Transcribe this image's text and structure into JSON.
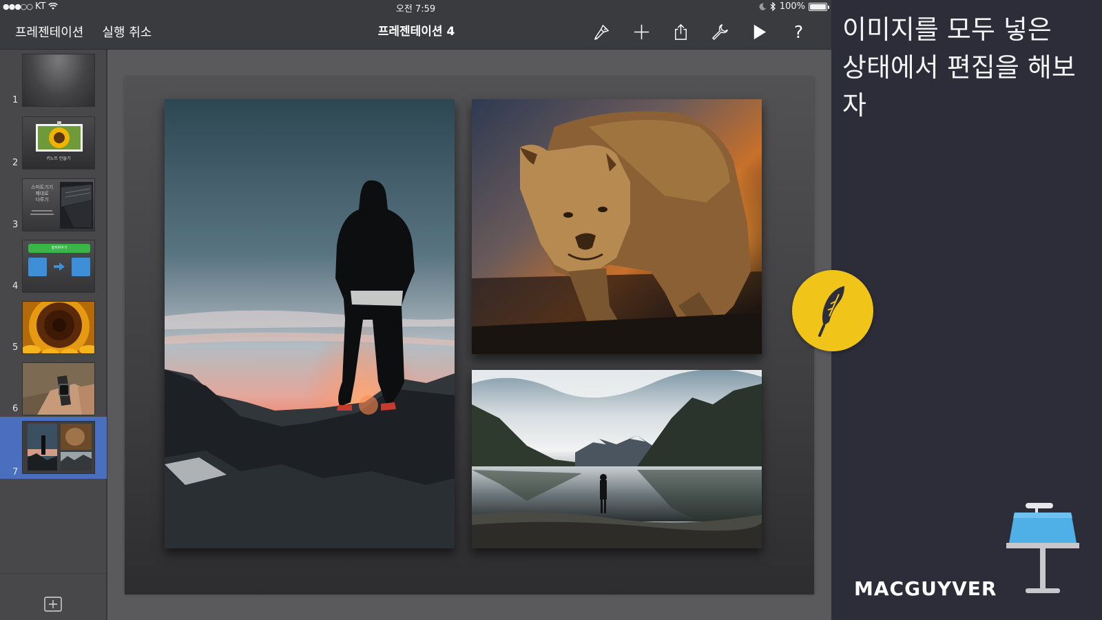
{
  "status_bar": {
    "carrier": "KT",
    "signal_dots": "●●●○○",
    "time": "오전 7:59",
    "battery": "100%",
    "battery_level": 1.0
  },
  "toolbar": {
    "presentations_label": "프레젠테이션",
    "undo_label": "실행 취소",
    "title": "프레젠테이션 4",
    "icons": [
      "format-brush-icon",
      "add-icon",
      "share-icon",
      "wrench-icon",
      "play-icon",
      "help-icon"
    ],
    "help_label": "?"
  },
  "sidebar": {
    "slides": [
      {
        "number": "1",
        "selected": false
      },
      {
        "number": "2",
        "caption": "키노트 만들기",
        "selected": false
      },
      {
        "number": "3",
        "text_lines": [
          "스마트기기",
          "제대로",
          "다루기"
        ],
        "selected": false
      },
      {
        "number": "4",
        "banner": "앞뒤바꾸기",
        "selected": false
      },
      {
        "number": "5",
        "selected": false
      },
      {
        "number": "6",
        "selected": false
      },
      {
        "number": "7",
        "selected": true
      }
    ],
    "add_slide_icon": "plus-square-icon",
    "selected_color": "#4a6fbf"
  },
  "right_panel": {
    "caption": "이미지를 모두 넣은\n상태에서 편집을 해보\n자",
    "brand": "MACGUYVER",
    "badge_icon": "feather-icon",
    "badge_color": "#f0c419",
    "logo_icon": "keynote-podium-icon"
  },
  "colors": {
    "toolbar_bg": "#3a3b3e",
    "panel_bg": "#2d2d39",
    "canvas_bg": "#5a5a5d"
  }
}
